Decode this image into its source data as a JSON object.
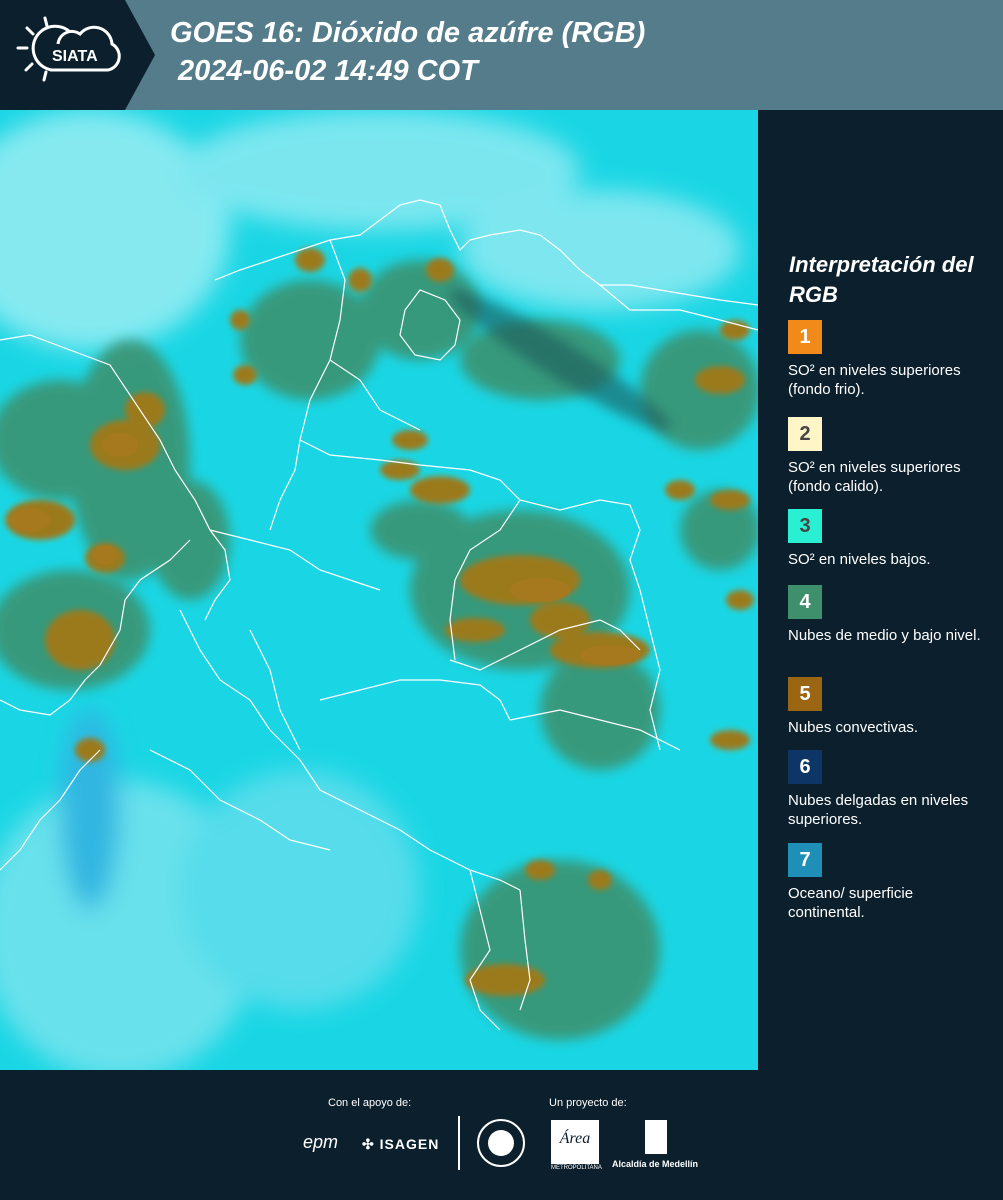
{
  "header": {
    "logo_text": "SIATA",
    "title_line1": "GOES 16: Dióxido de azúfre (RGB)",
    "title_line2": "2024-06-02 14:49 COT"
  },
  "legend": {
    "title": "Interpretación del RGB",
    "items": [
      {
        "number": "1",
        "label": "SO² en niveles superiores (fondo frio).",
        "color": "#f28a1a",
        "text_color": "#ffffff"
      },
      {
        "number": "2",
        "label": "SO² en niveles superiores (fondo calido).",
        "color": "#fff5c6",
        "text_color": "#444444"
      },
      {
        "number": "3",
        "label": "SO² en niveles bajos.",
        "color": "#29f0d2",
        "text_color": "#444444"
      },
      {
        "number": "4",
        "label": "Nubes de medio y bajo nivel.",
        "color": "#3e8f6b",
        "text_color": "#ffffff"
      },
      {
        "number": "5",
        "label": "Nubes convectivas.",
        "color": "#9b6612",
        "text_color": "#ffffff"
      },
      {
        "number": "6",
        "label": "Nubes delgadas en niveles superiores.",
        "color": "#0d3566",
        "text_color": "#ffffff"
      },
      {
        "number": "7",
        "label": "Oceano/ superficie continental.",
        "color": "#1f8fb8",
        "text_color": "#ffffff"
      }
    ]
  },
  "footer": {
    "support_label": "Con el apoyo de:",
    "project_label": "Un proyecto de:",
    "sponsors": [
      "epm",
      "ISAGEN"
    ],
    "partners": [
      "Área Metropolitana Valle de Aburrá",
      "Alcaldía de Medellín"
    ],
    "partner_logo_text": [
      "Área",
      "METROPOLITANA",
      "Valle de Aburrá",
      "Alcaldía de Medellín"
    ]
  },
  "colors": {
    "header_bg": "#557c8a",
    "panel_bg": "#0c1f2c",
    "surface": "#18d8e6",
    "clouds_mid_low": "#3e8f6b",
    "clouds_convective": "#9b6612"
  }
}
